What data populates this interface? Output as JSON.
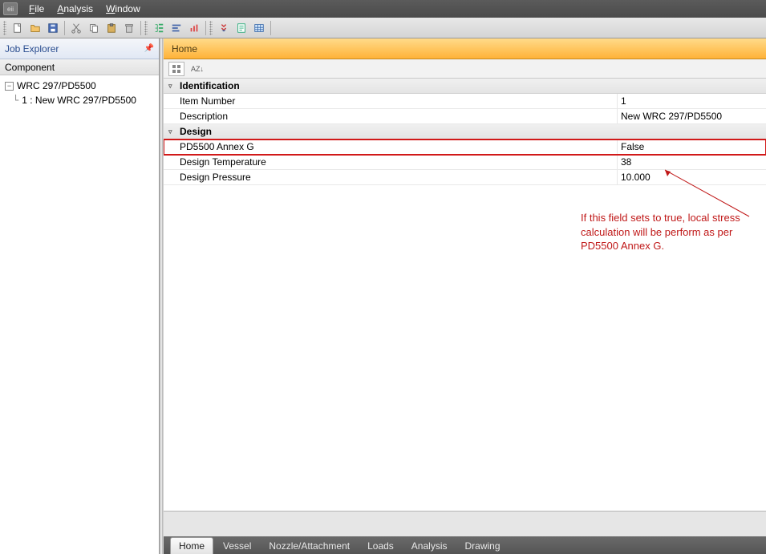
{
  "menu": {
    "items": [
      "File",
      "Analysis",
      "Window"
    ],
    "logo": "eii"
  },
  "toolbar_icons": [
    "new-doc-icon",
    "open-folder-icon",
    "save-icon",
    "sep",
    "cut-icon",
    "copy-icon",
    "paste-icon",
    "delete-icon",
    "sep",
    "tree-icon",
    "align-icon",
    "chart-icon",
    "sep",
    "run-icon",
    "report-icon",
    "grid-icon"
  ],
  "left_panel": {
    "title": "Job Explorer",
    "section": "Component",
    "root": "WRC 297/PD5500",
    "child": "1 : New WRC 297/PD5500"
  },
  "right_panel": {
    "tab_title": "Home",
    "sections": [
      {
        "title": "Identification",
        "rows": [
          {
            "label": "Item Number",
            "value": "1"
          },
          {
            "label": "Description",
            "value": "New WRC 297/PD5500"
          }
        ]
      },
      {
        "title": "Design",
        "rows": [
          {
            "label": "PD5500 Annex G",
            "value": "False",
            "highlight": true
          },
          {
            "label": "Design Temperature",
            "value": "38"
          },
          {
            "label": "Design Pressure",
            "value": "10.000"
          }
        ]
      }
    ],
    "annotation": "If this field sets to true, local stress calculation will be perform as per PD5500 Annex G."
  },
  "bottom_tabs": [
    "Home",
    "Vessel",
    "Nozzle/Attachment",
    "Loads",
    "Analysis",
    "Drawing"
  ],
  "active_bottom_tab": 0
}
